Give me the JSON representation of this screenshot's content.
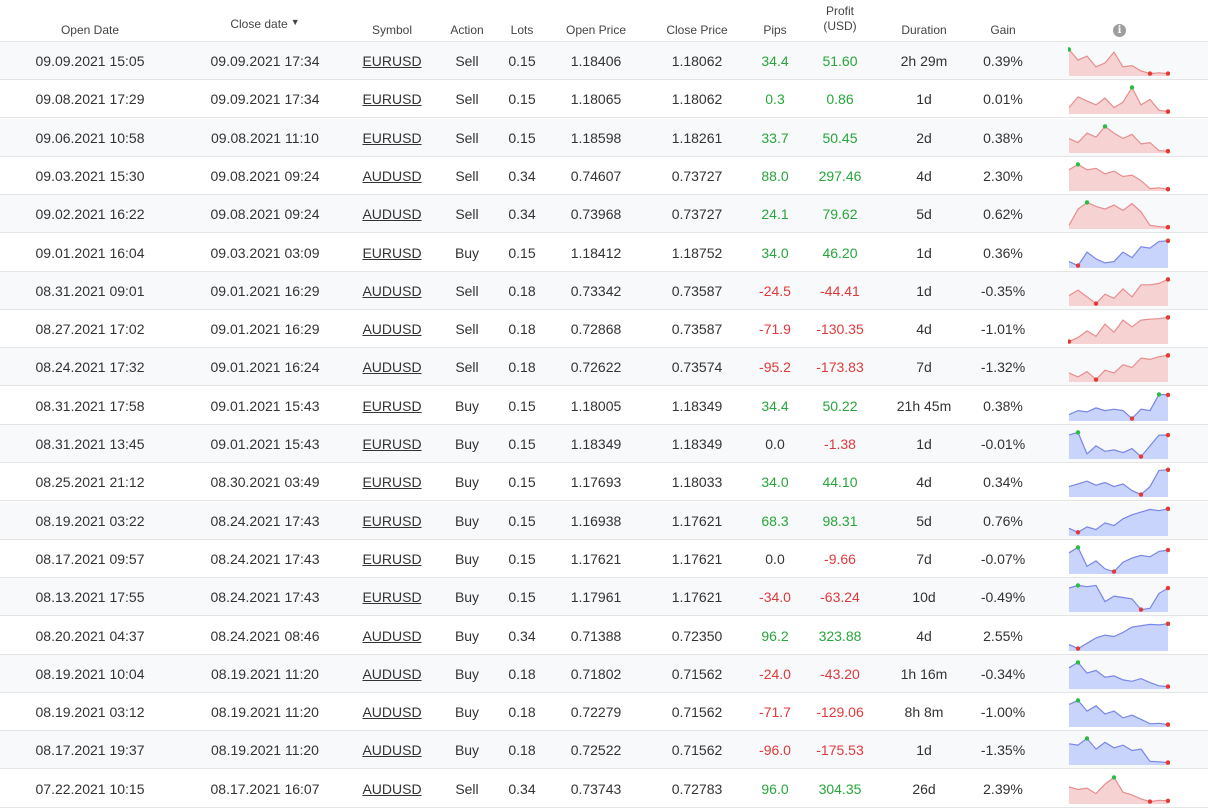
{
  "headers": {
    "open_date": "Open Date",
    "close_date": "Close date",
    "close_date_sort": "▼",
    "symbol": "Symbol",
    "action": "Action",
    "lots": "Lots",
    "open_price": "Open Price",
    "close_price": "Close Price",
    "pips": "Pips",
    "profit_l1": "Profit",
    "profit_l2": "(USD)",
    "duration": "Duration",
    "gain": "Gain",
    "info": "i"
  },
  "colors": {
    "positive": "#27a63a",
    "negative": "#e0393c",
    "sell_fill": "#f6d2d2",
    "sell_line": "#e88e8e",
    "buy_fill": "#c8d4fb",
    "buy_line": "#7a86e8",
    "marker_high": "#2dbb47",
    "marker_low": "#e53935"
  },
  "rows": [
    {
      "open": "09.09.2021 15:05",
      "close": "09.09.2021 17:34",
      "symbol": "EURUSD",
      "action": "Sell",
      "lots": "0.15",
      "open_price": "1.18406",
      "close_price": "1.18062",
      "pips": "34.4",
      "profit": "51.60",
      "duration": "2h 29m",
      "gain": "0.39%",
      "spark": [
        0.95,
        0.55,
        0.7,
        0.3,
        0.45,
        0.85,
        0.3,
        0.35,
        0.15,
        0.05,
        0.08,
        0.05
      ]
    },
    {
      "open": "09.08.2021 17:29",
      "close": "09.09.2021 17:34",
      "symbol": "EURUSD",
      "action": "Sell",
      "lots": "0.15",
      "open_price": "1.18065",
      "close_price": "1.18062",
      "pips": "0.3",
      "profit": "0.86",
      "duration": "1d",
      "gain": "0.01%",
      "spark": [
        0.2,
        0.6,
        0.45,
        0.3,
        0.55,
        0.2,
        0.4,
        0.95,
        0.3,
        0.5,
        0.1,
        0.05
      ]
    },
    {
      "open": "09.06.2021 10:58",
      "close": "09.08.2021 11:10",
      "symbol": "EURUSD",
      "action": "Sell",
      "lots": "0.15",
      "open_price": "1.18598",
      "close_price": "1.18261",
      "pips": "33.7",
      "profit": "50.45",
      "duration": "2d",
      "gain": "0.38%",
      "spark": [
        0.5,
        0.35,
        0.7,
        0.55,
        0.95,
        0.7,
        0.5,
        0.65,
        0.3,
        0.35,
        0.05,
        0.03
      ]
    },
    {
      "open": "09.03.2021 15:30",
      "close": "09.08.2021 09:24",
      "symbol": "AUDUSD",
      "action": "Sell",
      "lots": "0.34",
      "open_price": "0.74607",
      "close_price": "0.73727",
      "pips": "88.0",
      "profit": "297.46",
      "duration": "4d",
      "gain": "2.30%",
      "spark": [
        0.75,
        0.95,
        0.75,
        0.8,
        0.6,
        0.7,
        0.5,
        0.55,
        0.35,
        0.05,
        0.08,
        0.03
      ]
    },
    {
      "open": "09.02.2021 16:22",
      "close": "09.08.2021 09:24",
      "symbol": "AUDUSD",
      "action": "Sell",
      "lots": "0.34",
      "open_price": "0.73968",
      "close_price": "0.73727",
      "pips": "24.1",
      "profit": "79.62",
      "duration": "5d",
      "gain": "0.62%",
      "spark": [
        0.1,
        0.7,
        0.95,
        0.8,
        0.7,
        0.85,
        0.65,
        0.9,
        0.6,
        0.1,
        0.05,
        0.03
      ]
    },
    {
      "open": "09.01.2021 16:04",
      "close": "09.03.2021 03:09",
      "symbol": "EURUSD",
      "action": "Buy",
      "lots": "0.15",
      "open_price": "1.18412",
      "close_price": "1.18752",
      "pips": "34.0",
      "profit": "46.20",
      "duration": "1d",
      "gain": "0.36%",
      "spark": [
        0.2,
        0.05,
        0.55,
        0.3,
        0.15,
        0.2,
        0.55,
        0.35,
        0.75,
        0.7,
        0.95,
        0.97
      ]
    },
    {
      "open": "08.31.2021 09:01",
      "close": "09.01.2021 16:29",
      "symbol": "AUDUSD",
      "action": "Sell",
      "lots": "0.18",
      "open_price": "0.73342",
      "close_price": "0.73587",
      "pips": "-24.5",
      "profit": "-44.41",
      "duration": "1d",
      "gain": "-0.35%",
      "spark": [
        0.35,
        0.55,
        0.3,
        0.05,
        0.4,
        0.25,
        0.6,
        0.3,
        0.75,
        0.75,
        0.8,
        0.95
      ]
    },
    {
      "open": "08.27.2021 17:02",
      "close": "09.01.2021 16:29",
      "symbol": "AUDUSD",
      "action": "Sell",
      "lots": "0.18",
      "open_price": "0.72868",
      "close_price": "0.73587",
      "pips": "-71.9",
      "profit": "-130.35",
      "duration": "4d",
      "gain": "-1.01%",
      "spark": [
        0.05,
        0.2,
        0.45,
        0.25,
        0.7,
        0.4,
        0.85,
        0.6,
        0.85,
        0.88,
        0.9,
        0.95
      ]
    },
    {
      "open": "08.24.2021 17:32",
      "close": "09.01.2021 16:24",
      "symbol": "AUDUSD",
      "action": "Sell",
      "lots": "0.18",
      "open_price": "0.72622",
      "close_price": "0.73574",
      "pips": "-95.2",
      "profit": "-173.83",
      "duration": "7d",
      "gain": "-1.32%",
      "spark": [
        0.3,
        0.15,
        0.35,
        0.05,
        0.4,
        0.3,
        0.6,
        0.5,
        0.85,
        0.8,
        0.9,
        0.95
      ]
    },
    {
      "open": "08.31.2021 17:58",
      "close": "09.01.2021 15:43",
      "symbol": "EURUSD",
      "action": "Buy",
      "lots": "0.15",
      "open_price": "1.18005",
      "close_price": "1.18349",
      "pips": "34.4",
      "profit": "50.22",
      "duration": "21h 45m",
      "gain": "0.38%",
      "spark": [
        0.2,
        0.35,
        0.3,
        0.45,
        0.35,
        0.4,
        0.35,
        0.05,
        0.4,
        0.35,
        0.95,
        0.93
      ]
    },
    {
      "open": "08.31.2021 13:45",
      "close": "09.01.2021 15:43",
      "symbol": "EURUSD",
      "action": "Buy",
      "lots": "0.15",
      "open_price": "1.18349",
      "close_price": "1.18349",
      "pips": "0.0",
      "profit": "-1.38",
      "duration": "1d",
      "gain": "-0.01%",
      "spark": [
        0.85,
        0.95,
        0.15,
        0.45,
        0.25,
        0.3,
        0.2,
        0.35,
        0.05,
        0.45,
        0.85,
        0.85
      ]
    },
    {
      "open": "08.25.2021 21:12",
      "close": "08.30.2021 03:49",
      "symbol": "EURUSD",
      "action": "Buy",
      "lots": "0.15",
      "open_price": "1.17693",
      "close_price": "1.18033",
      "pips": "34.0",
      "profit": "44.10",
      "duration": "4d",
      "gain": "0.34%",
      "spark": [
        0.35,
        0.45,
        0.55,
        0.4,
        0.5,
        0.35,
        0.45,
        0.2,
        0.05,
        0.35,
        0.95,
        0.97
      ]
    },
    {
      "open": "08.19.2021 03:22",
      "close": "08.24.2021 17:43",
      "symbol": "EURUSD",
      "action": "Buy",
      "lots": "0.15",
      "open_price": "1.16938",
      "close_price": "1.17621",
      "pips": "68.3",
      "profit": "98.31",
      "duration": "5d",
      "gain": "0.76%",
      "spark": [
        0.25,
        0.1,
        0.3,
        0.2,
        0.45,
        0.35,
        0.6,
        0.75,
        0.85,
        0.95,
        0.9,
        0.97
      ]
    },
    {
      "open": "08.17.2021 09:57",
      "close": "08.24.2021 17:43",
      "symbol": "EURUSD",
      "action": "Buy",
      "lots": "0.15",
      "open_price": "1.17621",
      "close_price": "1.17621",
      "pips": "0.0",
      "profit": "-9.66",
      "duration": "7d",
      "gain": "-0.07%",
      "spark": [
        0.75,
        0.95,
        0.25,
        0.45,
        0.15,
        0.05,
        0.4,
        0.55,
        0.65,
        0.6,
        0.8,
        0.85
      ]
    },
    {
      "open": "08.13.2021 17:55",
      "close": "08.24.2021 17:43",
      "symbol": "EURUSD",
      "action": "Buy",
      "lots": "0.15",
      "open_price": "1.17961",
      "close_price": "1.17621",
      "pips": "-34.0",
      "profit": "-63.24",
      "duration": "10d",
      "gain": "-0.49%",
      "spark": [
        0.85,
        0.95,
        0.9,
        0.95,
        0.35,
        0.55,
        0.5,
        0.45,
        0.05,
        0.1,
        0.65,
        0.85
      ]
    },
    {
      "open": "08.20.2021 04:37",
      "close": "08.24.2021 08:46",
      "symbol": "AUDUSD",
      "action": "Buy",
      "lots": "0.34",
      "open_price": "0.71388",
      "close_price": "0.72350",
      "pips": "96.2",
      "profit": "323.88",
      "duration": "4d",
      "gain": "2.55%",
      "spark": [
        0.2,
        0.05,
        0.25,
        0.45,
        0.55,
        0.5,
        0.65,
        0.85,
        0.9,
        0.95,
        0.93,
        0.97
      ]
    },
    {
      "open": "08.19.2021 10:04",
      "close": "08.19.2021 11:20",
      "symbol": "AUDUSD",
      "action": "Buy",
      "lots": "0.18",
      "open_price": "0.71802",
      "close_price": "0.71562",
      "pips": "-24.0",
      "profit": "-43.20",
      "duration": "1h 16m",
      "gain": "-0.34%",
      "spark": [
        0.75,
        0.95,
        0.55,
        0.65,
        0.4,
        0.45,
        0.3,
        0.25,
        0.35,
        0.2,
        0.08,
        0.05
      ]
    },
    {
      "open": "08.19.2021 03:12",
      "close": "08.19.2021 11:20",
      "symbol": "AUDUSD",
      "action": "Buy",
      "lots": "0.18",
      "open_price": "0.72279",
      "close_price": "0.71562",
      "pips": "-71.7",
      "profit": "-129.06",
      "duration": "8h 8m",
      "gain": "-1.00%",
      "spark": [
        0.8,
        0.95,
        0.55,
        0.75,
        0.45,
        0.55,
        0.3,
        0.4,
        0.25,
        0.08,
        0.1,
        0.05
      ]
    },
    {
      "open": "08.17.2021 19:37",
      "close": "08.19.2021 11:20",
      "symbol": "AUDUSD",
      "action": "Buy",
      "lots": "0.18",
      "open_price": "0.72522",
      "close_price": "0.71562",
      "pips": "-96.0",
      "profit": "-175.53",
      "duration": "1d",
      "gain": "-1.35%",
      "spark": [
        0.75,
        0.7,
        0.95,
        0.55,
        0.8,
        0.6,
        0.7,
        0.5,
        0.55,
        0.1,
        0.08,
        0.05
      ]
    },
    {
      "open": "07.22.2021 10:15",
      "close": "08.17.2021 16:07",
      "symbol": "AUDUSD",
      "action": "Sell",
      "lots": "0.34",
      "open_price": "0.73743",
      "close_price": "0.72783",
      "pips": "96.0",
      "profit": "304.35",
      "duration": "26d",
      "gain": "2.39%",
      "spark": [
        0.6,
        0.5,
        0.55,
        0.35,
        0.7,
        0.95,
        0.4,
        0.3,
        0.15,
        0.05,
        0.1,
        0.08
      ]
    }
  ]
}
